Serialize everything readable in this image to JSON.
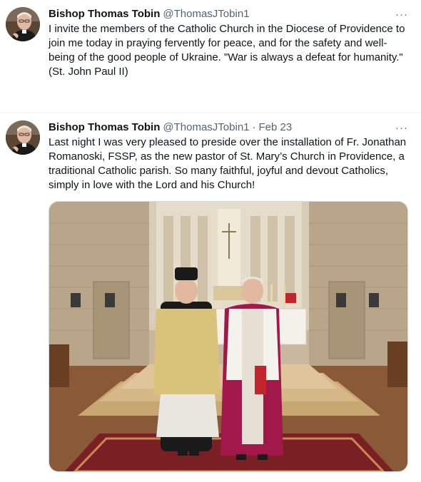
{
  "tweets": [
    {
      "author_name": "Bishop Thomas Tobin",
      "handle": "@ThomasJTobin1",
      "date": "",
      "text": "I invite the members of the Catholic Church in the Diocese of Providence to join me today in praying fervently for peace, and for the safety and well-being of the good people of Ukraine. \"War is always a defeat for humanity.\" (St. John Paul II)",
      "more_label": "···",
      "avatar_icon": "bishop-avatar"
    },
    {
      "author_name": "Bishop Thomas Tobin",
      "handle": "@ThomasJTobin1",
      "separator": "·",
      "date": "Feb 23",
      "text": "Last night I was very pleased to preside over the installation of Fr. Jonathan Romanoski, FSSP, as the new pastor of St. Mary’s Church in Providence, a traditional Catholic parish. So many faithful, joyful and devout Catholics, simply in love with the Lord and his Church!",
      "more_label": "···",
      "avatar_icon": "bishop-avatar"
    }
  ]
}
